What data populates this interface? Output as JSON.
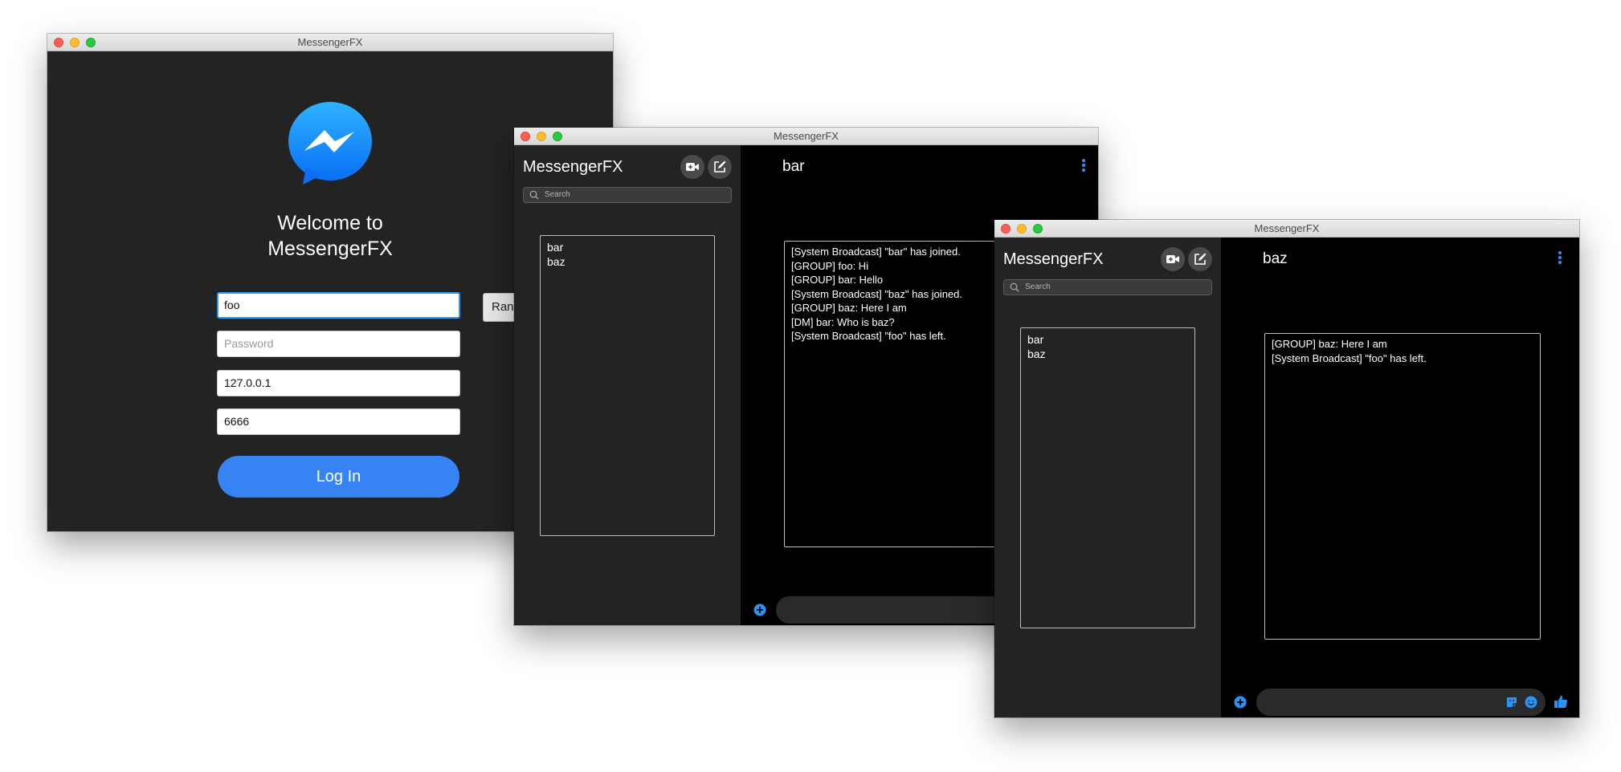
{
  "login_window": {
    "title": "MessengerFX",
    "welcome_line1": "Welcome to",
    "welcome_line2": "MessengerFX",
    "username_value": "foo",
    "password_placeholder": "Password",
    "host_value": "127.0.0.1",
    "port_value": "6666",
    "login_label": "Log In",
    "random_button_label": "Rand"
  },
  "window_bar": {
    "title": "MessengerFX",
    "app_name": "MessengerFX",
    "search_placeholder": "Search",
    "users": [
      "bar",
      "baz"
    ],
    "chat_name": "bar",
    "messages": [
      "[System Broadcast] \"bar\" has joined.",
      "[GROUP] foo: Hi",
      "[GROUP] bar: Hello",
      "[System Broadcast] \"baz\" has joined.",
      "[GROUP] baz: Here I am",
      "[DM] bar:  Who is baz?",
      "[System Broadcast] \"foo\" has left."
    ]
  },
  "window_baz": {
    "title": "MessengerFX",
    "app_name": "MessengerFX",
    "search_placeholder": "Search",
    "users": [
      "bar",
      "baz"
    ],
    "chat_name": "baz",
    "messages": [
      "[GROUP] baz: Here I am",
      "[System Broadcast] \"foo\" has left."
    ]
  },
  "colors": {
    "accent": "#3684f3",
    "icon_blue": "#2b93f3",
    "sidebar_bg": "#232323",
    "chat_bg": "#000000"
  },
  "icons": [
    "messenger-logo",
    "video-call-icon",
    "compose-icon",
    "search-icon",
    "more-vert-icon",
    "add-circle-icon",
    "sticker-icon",
    "emoji-icon",
    "thumbs-up-icon"
  ]
}
